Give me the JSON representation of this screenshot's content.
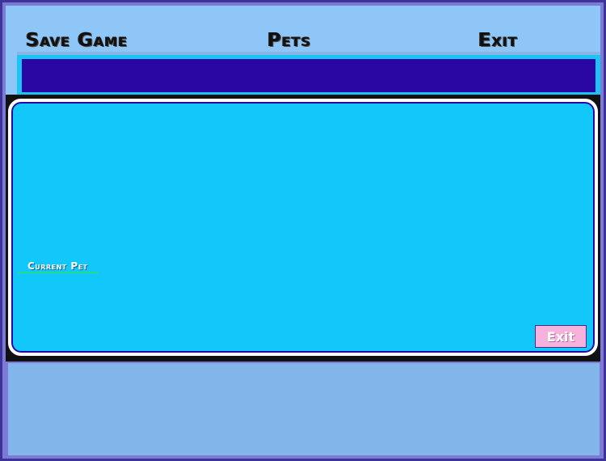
{
  "menu": {
    "save_game": "Save Game",
    "pets": "Pets",
    "exit": "Exit"
  },
  "main": {
    "current_pet_label": "Current Pet",
    "exit_button_label": "Exit"
  },
  "colors": {
    "top_panel": "#8ec6f7",
    "status_bar_inner": "#2a07a2",
    "main_panel": "#12c8fb",
    "exit_button": "#f7b2dc",
    "bottom_panel": "#82b5e9"
  }
}
